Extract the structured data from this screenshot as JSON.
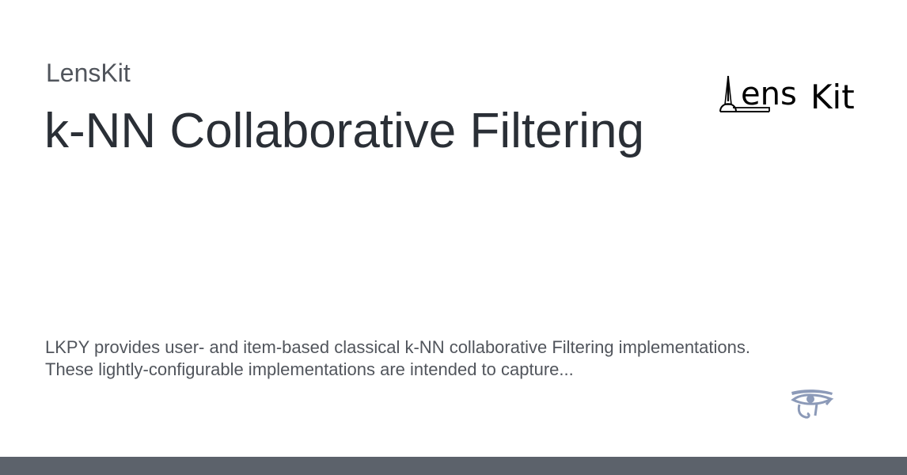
{
  "header": {
    "site_name": "LensKit",
    "title": "k-NN Collaborative Filtering"
  },
  "logo": {
    "icon": "lenskit-logo-icon",
    "text_a": "ens",
    "text_b": "Kit"
  },
  "description": {
    "line1": "LKPY provides user- and item-based classical k-NN collaborative Filtering implementations.",
    "line2": "These lightly-configurable implementations are intended to capture..."
  },
  "badge": {
    "icon": "eye-of-horus-icon"
  },
  "colors": {
    "text_dark": "#2a2f36",
    "text_muted": "#51555c",
    "footer_bar": "#5c626b",
    "eye_icon": "#8c9ab8"
  }
}
